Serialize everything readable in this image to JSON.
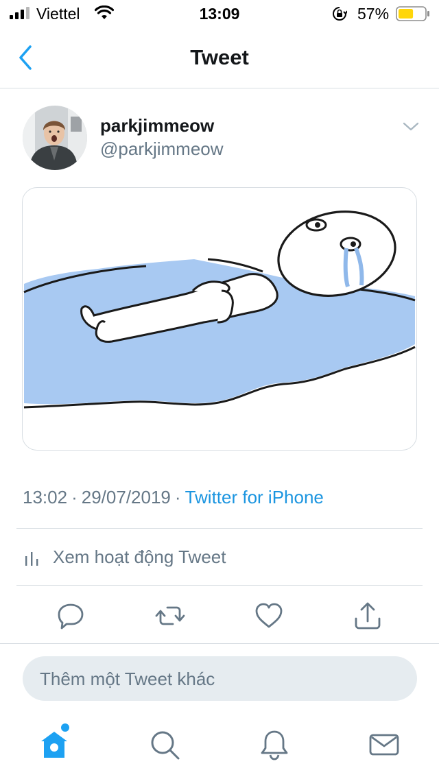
{
  "status_bar": {
    "carrier": "Viettel",
    "time": "13:09",
    "battery_percent": "57%",
    "battery_level": 0.57,
    "icons": [
      "signal-icon",
      "wifi-icon",
      "orientation-lock-icon",
      "battery-icon"
    ]
  },
  "nav": {
    "title": "Tweet",
    "back_icon": "chevron-left-icon"
  },
  "tweet": {
    "display_name": "parkjimmeow",
    "handle": "@parkjimmeow",
    "time": "13:02",
    "date": "29/07/2019",
    "separator": "·",
    "source": "Twitter for iPhone",
    "media": "cartoon figure lying in a puddle of tears"
  },
  "activity": {
    "label": "Xem hoạt động Tweet",
    "icon": "bar-chart-icon"
  },
  "actions": [
    "reply-icon",
    "retweet-icon",
    "like-icon",
    "share-icon"
  ],
  "reply": {
    "placeholder": "Thêm một Tweet khác"
  },
  "tab_bar": {
    "items": [
      "home-icon",
      "search-icon",
      "notifications-icon",
      "messages-icon"
    ],
    "home_has_notification": true
  },
  "colors": {
    "accent": "#1da1f2",
    "link": "#1b95e0",
    "secondary_text": "#657786",
    "battery": "#ffd60a",
    "divider": "#d7dde2"
  }
}
